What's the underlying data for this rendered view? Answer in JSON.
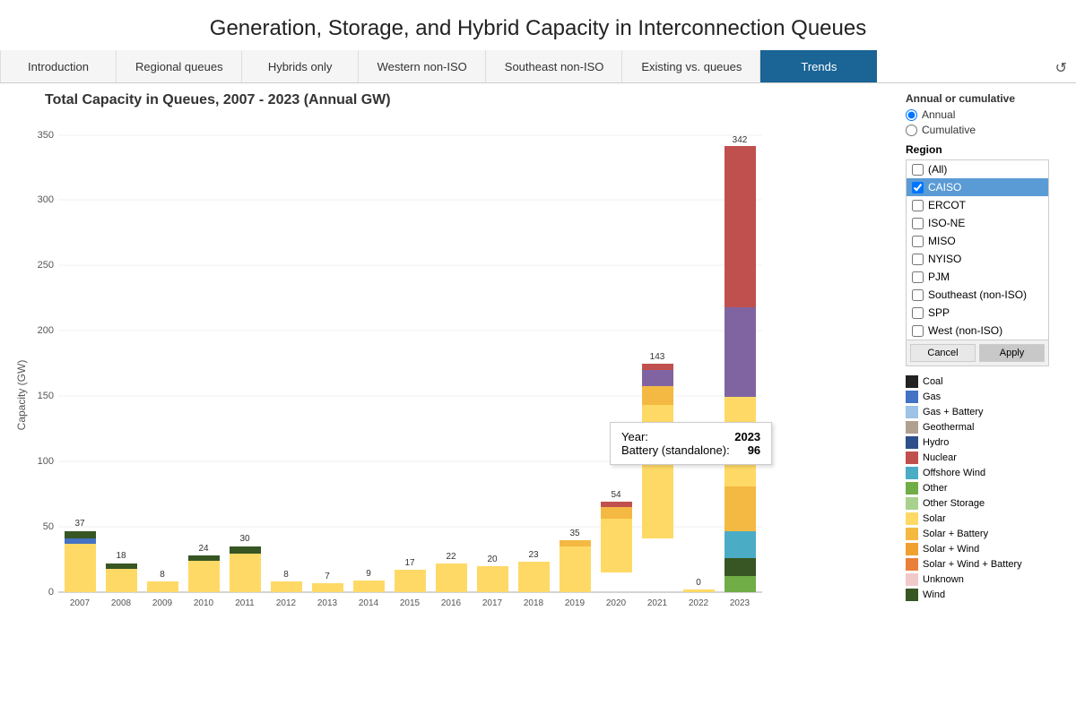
{
  "page": {
    "title": "Generation, Storage, and Hybrid Capacity in Interconnection Queues"
  },
  "nav": {
    "tabs": [
      {
        "label": "Introduction",
        "active": false
      },
      {
        "label": "Regional queues",
        "active": false
      },
      {
        "label": "Hybrids only",
        "active": false
      },
      {
        "label": "Western non-ISO",
        "active": false
      },
      {
        "label": "Southeast non-ISO",
        "active": false
      },
      {
        "label": "Existing vs. queues",
        "active": false
      },
      {
        "label": "Trends",
        "active": true
      }
    ]
  },
  "chart": {
    "title": "Total Capacity in Queues, 2007 - 2023 (Annual GW)",
    "y_axis_label": "Capacity (GW)",
    "y_ticks": [
      "0",
      "50",
      "100",
      "150",
      "200",
      "250",
      "300",
      "350"
    ],
    "bars": [
      {
        "year": "2007",
        "total": 37,
        "height_pct": 10.6
      },
      {
        "year": "2008",
        "total": 18,
        "height_pct": 5.1
      },
      {
        "year": "2009",
        "total": 8,
        "height_pct": 2.3
      },
      {
        "year": "2010",
        "total": 24,
        "height_pct": 6.9
      },
      {
        "year": "2011",
        "total": 30,
        "height_pct": 8.6
      },
      {
        "year": "2012",
        "total": 8,
        "height_pct": 2.3
      },
      {
        "year": "2013",
        "total": 7,
        "height_pct": 2.0
      },
      {
        "year": "2014",
        "total": 9,
        "height_pct": 2.6
      },
      {
        "year": "2015",
        "total": 17,
        "height_pct": 4.9
      },
      {
        "year": "2016",
        "total": 22,
        "height_pct": 6.3
      },
      {
        "year": "2017",
        "total": 20,
        "height_pct": 5.7
      },
      {
        "year": "2018",
        "total": 23,
        "height_pct": 6.6
      },
      {
        "year": "2019",
        "total": 35,
        "height_pct": 10.0
      },
      {
        "year": "2020",
        "total": 54,
        "height_pct": 15.5
      },
      {
        "year": "2021",
        "total": 143,
        "height_pct": 41.0
      },
      {
        "year": "2022",
        "total": 0,
        "height_pct": 0
      },
      {
        "year": "2023",
        "total": 342,
        "height_pct": 98.0
      }
    ]
  },
  "annual_section": {
    "label": "Annual or cumulative",
    "options": [
      {
        "label": "Annual",
        "selected": true
      },
      {
        "label": "Cumulative",
        "selected": false
      }
    ]
  },
  "region_section": {
    "label": "Region",
    "items": [
      {
        "label": "(All)",
        "checked": false
      },
      {
        "label": "CAISO",
        "checked": true,
        "selected": true
      },
      {
        "label": "ERCOT",
        "checked": false
      },
      {
        "label": "ISO-NE",
        "checked": false
      },
      {
        "label": "MISO",
        "checked": false
      },
      {
        "label": "NYISO",
        "checked": false
      },
      {
        "label": "PJM",
        "checked": false
      },
      {
        "label": "Southeast (non-ISO)",
        "checked": false
      },
      {
        "label": "SPP",
        "checked": false
      },
      {
        "label": "West (non-ISO)",
        "checked": false
      }
    ],
    "buttons": {
      "cancel": "Cancel",
      "apply": "Apply"
    }
  },
  "tooltip": {
    "year_label": "Year:",
    "year_value": "2023",
    "battery_label": "Battery (standalone):",
    "battery_value": "96"
  },
  "legend": {
    "items": [
      {
        "label": "Coal",
        "color": "#222222"
      },
      {
        "label": "Gas",
        "color": "#4472c4"
      },
      {
        "label": "Gas + Battery",
        "color": "#9dc3e6"
      },
      {
        "label": "Geothermal",
        "color": "#b0a090"
      },
      {
        "label": "Hydro",
        "color": "#2e4f8c"
      },
      {
        "label": "Nuclear",
        "color": "#c0504d"
      },
      {
        "label": "Offshore Wind",
        "color": "#4bacc6"
      },
      {
        "label": "Other",
        "color": "#70ad47"
      },
      {
        "label": "Other Storage",
        "color": "#a9d18e"
      },
      {
        "label": "Solar",
        "color": "#ffd966"
      },
      {
        "label": "Solar + Battery",
        "color": "#f4b942"
      },
      {
        "label": "Solar + Wind",
        "color": "#f0a030"
      },
      {
        "label": "Solar + Wind + Battery",
        "color": "#e8803a"
      },
      {
        "label": "Unknown",
        "color": "#f2c9c9"
      },
      {
        "label": "Wind",
        "color": "#375623"
      }
    ]
  }
}
